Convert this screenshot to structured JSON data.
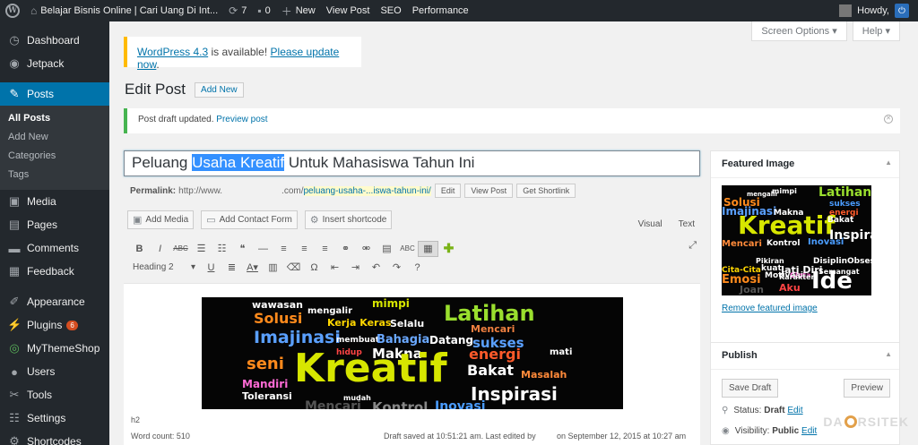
{
  "admin_bar": {
    "site_name": "Belajar Bisnis Online | Cari Uang Di Int...",
    "updates_count": "7",
    "comments_count": "0",
    "new_label": "New",
    "view_post_label": "View Post",
    "seo_label": "SEO",
    "performance_label": "Performance",
    "howdy_label": "Howdy,"
  },
  "sidebar": {
    "dashboard": "Dashboard",
    "jetpack": "Jetpack",
    "posts": "Posts",
    "posts_sub": [
      "All Posts",
      "Add New",
      "Categories",
      "Tags"
    ],
    "media": "Media",
    "pages": "Pages",
    "comments": "Comments",
    "feedback": "Feedback",
    "appearance": "Appearance",
    "plugins": "Plugins",
    "plugins_badge": "6",
    "mythemeshop": "MyThemeShop",
    "users": "Users",
    "tools": "Tools",
    "settings": "Settings",
    "shortcodes": "Shortcodes"
  },
  "screen_tabs": {
    "screen_options": "Screen Options",
    "help": "Help"
  },
  "update_notice": {
    "version_link": "WordPress 4.3",
    "middle": " is available! ",
    "update_link": "Please update now",
    "end": "."
  },
  "heading": {
    "title": "Edit Post",
    "add_new": "Add New"
  },
  "draft_notice": {
    "text": "Post draft updated. ",
    "link": "Preview post"
  },
  "post": {
    "title_before": "Peluang ",
    "title_selected": "Usaha Kreatif",
    "title_after": " Untuk Mahasiswa Tahun Ini",
    "permalink_label": "Permalink:",
    "permalink_base": "http://www.",
    "permalink_domain": ".com/",
    "permalink_slug": "peluang-usaha-...iswa-tahun-ini/",
    "edit_btn": "Edit",
    "view_btn": "View Post",
    "shortlink_btn": "Get Shortlink"
  },
  "editor": {
    "add_media": "Add Media",
    "add_contact_form": "Add Contact Form",
    "insert_shortcode": "Insert shortcode",
    "visual_tab": "Visual",
    "text_tab": "Text",
    "format_select": "Heading 2",
    "path": "h2",
    "word_count": "Word count: 510",
    "draft_saved": "Draft saved at 10:51:21 am. Last edited by",
    "last_edited": "on September 12, 2015 at 10:27 am"
  },
  "word_cloud_main": [
    "wawasan",
    "mimpi",
    "mengalir",
    "Latihan",
    "Solusi",
    "Kerja Keras",
    "Selalu",
    "Mencari",
    "Imajinasi",
    "membuat",
    "Bahagia",
    "Datang",
    "sukses",
    "seni",
    "hidup",
    "Makna",
    "energi",
    "mati",
    "Kreatif",
    "Bakat",
    "Masalah",
    "Mandiri",
    "Toleransi",
    "Inspirasi",
    "mudah",
    "Mencari",
    "Kontrol",
    "Inovasi"
  ],
  "word_cloud_featured": [
    "mimpi",
    "Latihan",
    "mengalir",
    "Solusi",
    "sukses",
    "Imajinasi",
    "Makna",
    "energi",
    "Kreatif",
    "Bakat",
    "Mencari",
    "Kontrol",
    "Inovasi",
    "Inspirasi",
    "Cita-Cita",
    "Pikiran",
    "Disiplin",
    "Obsesi",
    "Motivasi",
    "Cinta",
    "kuat",
    "Jati Diri",
    "Semangat",
    "Emosi",
    "Ide",
    "Joan",
    "Aku",
    "Karakter"
  ],
  "featured_image": {
    "title": "Featured Image",
    "remove_link": "Remove featured image"
  },
  "publish": {
    "title": "Publish",
    "save_draft": "Save Draft",
    "preview": "Preview",
    "status_label": "Status: ",
    "status_value": "Draft",
    "status_edit": "Edit",
    "visibility_label": "Visibility: ",
    "visibility_value": "Public",
    "visibility_edit": "Edit"
  },
  "watermark": {
    "part1": "DA",
    "part2": "RSITEK"
  }
}
